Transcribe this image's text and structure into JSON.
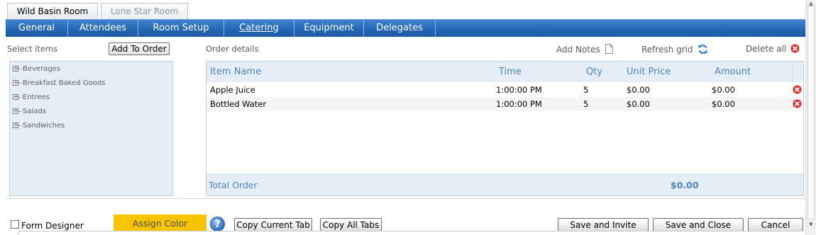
{
  "room_tabs": [
    {
      "label": "Wild Basin Room"
    },
    {
      "label": "Lone Star Room"
    }
  ],
  "nav": [
    {
      "label": "General"
    },
    {
      "label": "Attendees"
    },
    {
      "label": "Room Setup"
    },
    {
      "label": "Catering"
    },
    {
      "label": "Equipment"
    },
    {
      "label": "Delegates"
    }
  ],
  "left_panel": {
    "select_label": "Select items",
    "add_button": "Add To Order",
    "tree": [
      {
        "label": "Beverages"
      },
      {
        "label": "Breakfast Baked Goods"
      },
      {
        "label": "Entrees"
      },
      {
        "label": "Salads"
      },
      {
        "label": "Sandwiches"
      }
    ]
  },
  "order": {
    "title": "Order details",
    "add_notes": "Add Notes",
    "refresh": "Refresh grid",
    "delete_all": "Delete all",
    "columns": {
      "item": "Item Name",
      "time": "Time",
      "qty": "Qty",
      "unit": "Unit Price",
      "amount": "Amount"
    },
    "rows": [
      {
        "item": "Apple Juice",
        "time": "1:00:00 PM",
        "qty": "5",
        "unit": "$0.00",
        "amount": "$0.00"
      },
      {
        "item": "Bottled Water",
        "time": "1:00:00 PM",
        "qty": "5",
        "unit": "$0.00",
        "amount": "$0.00"
      }
    ],
    "total_label": "Total Order",
    "total_value": "$0.00"
  },
  "bottom": {
    "form_designer": "Form Designer",
    "assign_color": "Assign Color",
    "help": "?",
    "copy_current": "Copy Current Tab",
    "copy_all": "Copy All Tabs",
    "save_invite": "Save and Invite",
    "save_close": "Save and Close",
    "cancel": "Cancel"
  },
  "colors": {
    "nav_bar": "#2265b3",
    "header_text": "#4e83c0",
    "panel_bg": "#e5edf6",
    "assign_color": "#f7c500",
    "delete_red": "#e0302a"
  }
}
